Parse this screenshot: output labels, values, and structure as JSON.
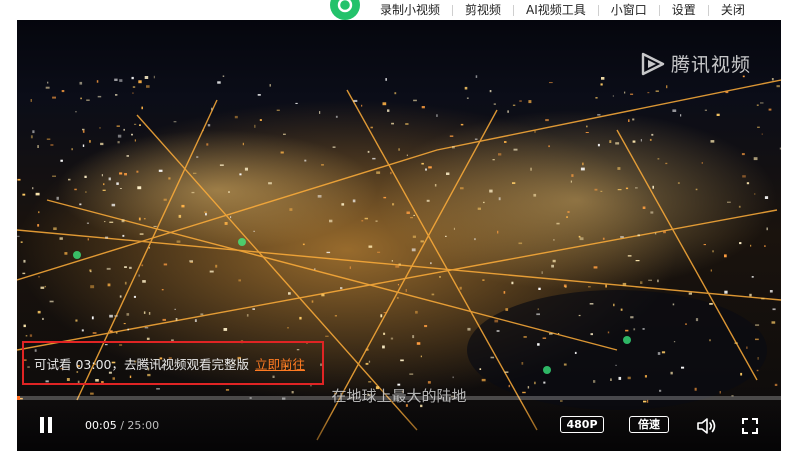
{
  "toolbar": {
    "items": [
      {
        "label": "录制小视频"
      },
      {
        "label": "剪视频"
      },
      {
        "label": "AI视频工具"
      },
      {
        "label": "小窗口"
      },
      {
        "label": "设置"
      },
      {
        "label": "关闭"
      }
    ]
  },
  "player": {
    "watermark": "腾讯视频",
    "trial_text": "可试看 03:00，去腾讯视频观看完整版",
    "trial_link": "立即前往",
    "subtitle": "在地球上最大的陆地",
    "current_time": "00:05",
    "time_separator": " / ",
    "total_time": "25:00",
    "progress_fraction": 0.0033,
    "quality": "480P",
    "speed": "倍速",
    "accent_color": "#ff6b1f",
    "highlight_border_color": "#e02424",
    "icons": [
      "play-logo-icon",
      "pause-icon",
      "volume-icon",
      "fullscreen-icon"
    ]
  }
}
